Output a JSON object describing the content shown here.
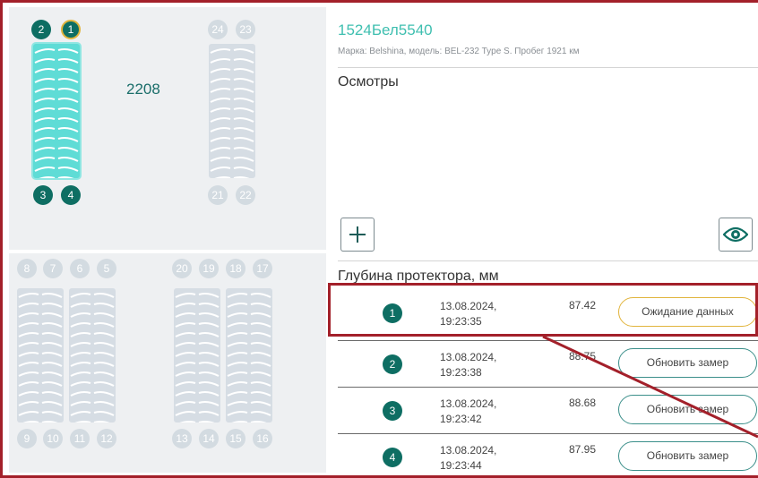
{
  "vehicle": {
    "plate": "1524Бел5540",
    "subtitle": "Марка: Belshina, модель: BEL-232 Type S. Пробег 1921 км"
  },
  "inspections": {
    "title": "Осмотры",
    "add_icon": "plus-icon",
    "view_icon": "eye-icon"
  },
  "tread": {
    "title": "Глубина протектора, мм",
    "rows": [
      {
        "num": "1",
        "date": "13.08.2024,",
        "time": "19:23:35",
        "value": "87.42",
        "button": "Ожидание данных",
        "state": "waiting"
      },
      {
        "num": "2",
        "date": "13.08.2024,",
        "time": "19:23:38",
        "value": "88.75",
        "button": "Обновить замер",
        "state": "ready"
      },
      {
        "num": "3",
        "date": "13.08.2024,",
        "time": "19:23:42",
        "value": "88.68",
        "button": "Обновить замер",
        "state": "ready"
      },
      {
        "num": "4",
        "date": "13.08.2024,",
        "time": "19:23:44",
        "value": "87.95",
        "button": "Обновить замер",
        "state": "ready"
      }
    ]
  },
  "axle": {
    "label": "2208",
    "front": {
      "left_top": [
        "2",
        "1"
      ],
      "left_bottom": [
        "3",
        "4"
      ],
      "right_top": [
        "24",
        "23"
      ],
      "right_bottom": [
        "21",
        "22"
      ],
      "selected": "1"
    },
    "rear": {
      "left_top": [
        "8",
        "7",
        "6",
        "5"
      ],
      "left_bottom": [
        "9",
        "10",
        "11",
        "12"
      ],
      "right_top": [
        "20",
        "19",
        "18",
        "17"
      ],
      "right_bottom": [
        "13",
        "14",
        "15",
        "16"
      ]
    }
  },
  "colors": {
    "accent": "#0e6e63",
    "plate": "#3fbfb0",
    "active_tire": "#5fdcd6",
    "waiting_border": "#e1b43c",
    "highlight": "#a3202a"
  }
}
